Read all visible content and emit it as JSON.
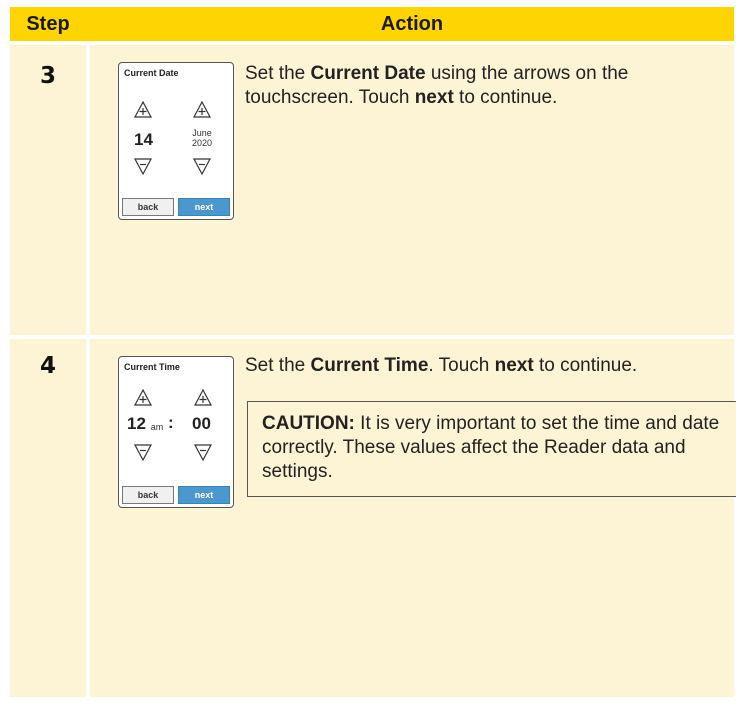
{
  "header": {
    "step": "Step",
    "action": "Action"
  },
  "rows": [
    {
      "step": "3",
      "device": {
        "title": "Current Date",
        "left_value": "14",
        "right_value_line1": "June",
        "right_value_line2": "2020",
        "back_label": "back",
        "next_label": "next"
      },
      "text": {
        "p1": "Set the ",
        "b1": "Current Date",
        "p2": " using the arrows on the touchscreen. Touch ",
        "b2": "next",
        "p3": " to continue."
      }
    },
    {
      "step": "4",
      "device": {
        "title": "Current Time",
        "hour": "12",
        "ampm": "am",
        "separator": ":",
        "minute": "00",
        "back_label": "back",
        "next_label": "next"
      },
      "text": {
        "p1": "Set the ",
        "b1": "Current Time",
        "p2": ". Touch ",
        "b2": "next",
        "p3": " to continue."
      },
      "caution": {
        "label": "CAUTION:",
        "text": " It is very important to set the time and date correctly. These values affect the Reader data and settings."
      }
    }
  ],
  "icons": {
    "up": "triangle-up-plus-icon",
    "down": "triangle-down-minus-icon"
  },
  "colors": {
    "header": "#ffd400",
    "cell": "#fdf4d6",
    "next_button": "#4a98cd"
  }
}
